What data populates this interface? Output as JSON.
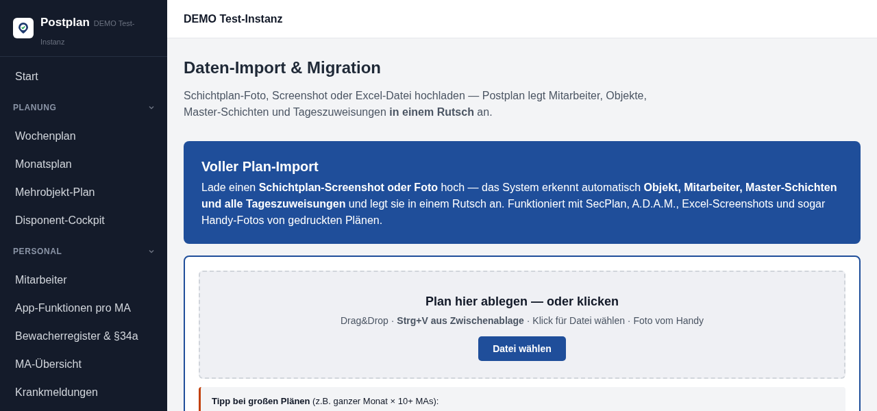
{
  "brand": {
    "name": "Postplan",
    "subtitle": "DEMO Test-Instanz"
  },
  "sidebar": [
    {
      "kind": "link",
      "label": "Start"
    },
    {
      "kind": "section",
      "label": "PLANUNG",
      "expanded": true,
      "children": [
        {
          "label": "Wochenplan"
        },
        {
          "label": "Monatsplan"
        },
        {
          "label": "Mehrobjekt-Plan"
        },
        {
          "label": "Disponent-Cockpit"
        }
      ]
    },
    {
      "kind": "section",
      "label": "PERSONAL",
      "expanded": true,
      "children": [
        {
          "label": "Mitarbeiter"
        },
        {
          "label": "App-Funktionen pro MA"
        },
        {
          "label": "Bewacherregister & §34a"
        },
        {
          "label": "MA-Übersicht"
        },
        {
          "label": "Krankmeldungen"
        }
      ]
    }
  ],
  "header": {
    "title": "DEMO Test-Instanz"
  },
  "page": {
    "title": "Daten-Import & Migration",
    "intro": "Schichtplan-Foto, Screenshot oder Excel-Datei hochladen — Postplan legt Mitarbeiter, Objekte, Master-Schichten und Tageszuweisungen **in einem Rutsch** an."
  },
  "banner": {
    "title": "Voller Plan-Import",
    "text": "Lade einen **Schichtplan-Screenshot oder Foto** hoch — das System erkennt automatisch **Objekt, Mitarbeiter, Master-Schichten und alle Tageszuweisungen** und legt sie in einem Rutsch an. Funktioniert mit SecPlan, A.D.A.M., Excel-Screenshots und sogar Handy-Fotos von gedruckten Plänen."
  },
  "dropzone": {
    "title": "Plan hier ablegen — oder klicken",
    "hint": "Drag&Drop · **Strg+V aus Zwischenablage** · Klick für Datei wählen · Foto vom Handy",
    "button": "Datei wählen"
  },
  "tip": {
    "text": "**Tipp bei großen Plänen** (z.B. ganzer Monat × 10+ MAs):"
  }
}
